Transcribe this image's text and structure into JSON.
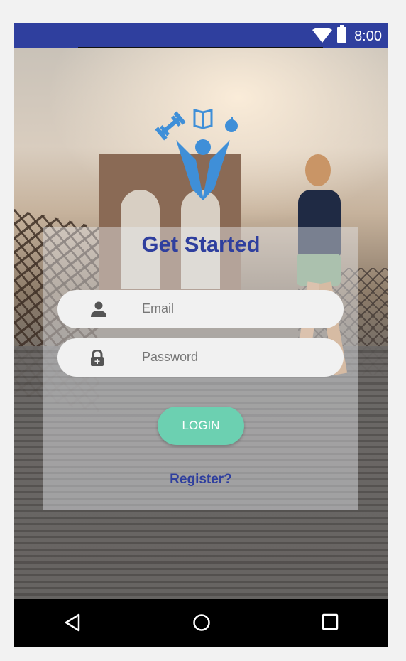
{
  "status_bar": {
    "time": "8:00",
    "bg_color": "#2f3f9e"
  },
  "login_screen": {
    "title": "Get Started",
    "email": {
      "placeholder": "Email",
      "icon": "person-icon"
    },
    "password": {
      "placeholder": "Password",
      "icon": "lock-icon"
    },
    "login_label": "LOGIN",
    "register_label": "Register?"
  },
  "colors": {
    "accent": "#2f3f9e",
    "login_button": "#6cd0b1",
    "logo_blue": "#3f8fd8"
  },
  "nav_bar": {
    "back": "back-triangle-icon",
    "home": "home-circle-icon",
    "recents": "recents-square-icon"
  }
}
